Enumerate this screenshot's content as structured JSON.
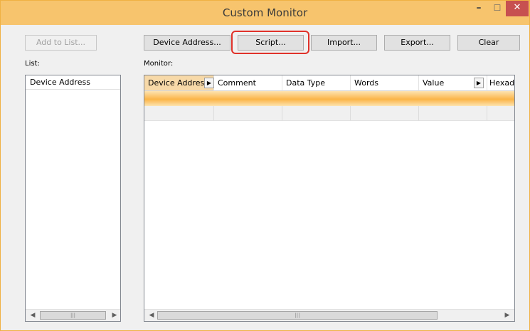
{
  "window": {
    "title": "Custom Monitor",
    "minimize": "–",
    "maximize": "☐",
    "close": "✕"
  },
  "toolbar": {
    "add_to_list": "Add to List...",
    "device_address": "Device Address...",
    "script": "Script...",
    "import": "Import...",
    "export": "Export...",
    "clear": "Clear"
  },
  "list": {
    "label": "List:",
    "header": "Device Address"
  },
  "monitor": {
    "label": "Monitor:",
    "columns": [
      "Device Address",
      "Comment",
      "Data Type",
      "Words",
      "Value",
      "Hexadecimal"
    ]
  },
  "scroll": {
    "left": "◀",
    "right": "▶",
    "grip": "|||"
  },
  "icons": {
    "column_arrow": "▶"
  },
  "colors": {
    "titlebar": "#f7c46d",
    "close": "#c75050",
    "highlight": "#e0322a",
    "row_selected": "#fbb548"
  }
}
